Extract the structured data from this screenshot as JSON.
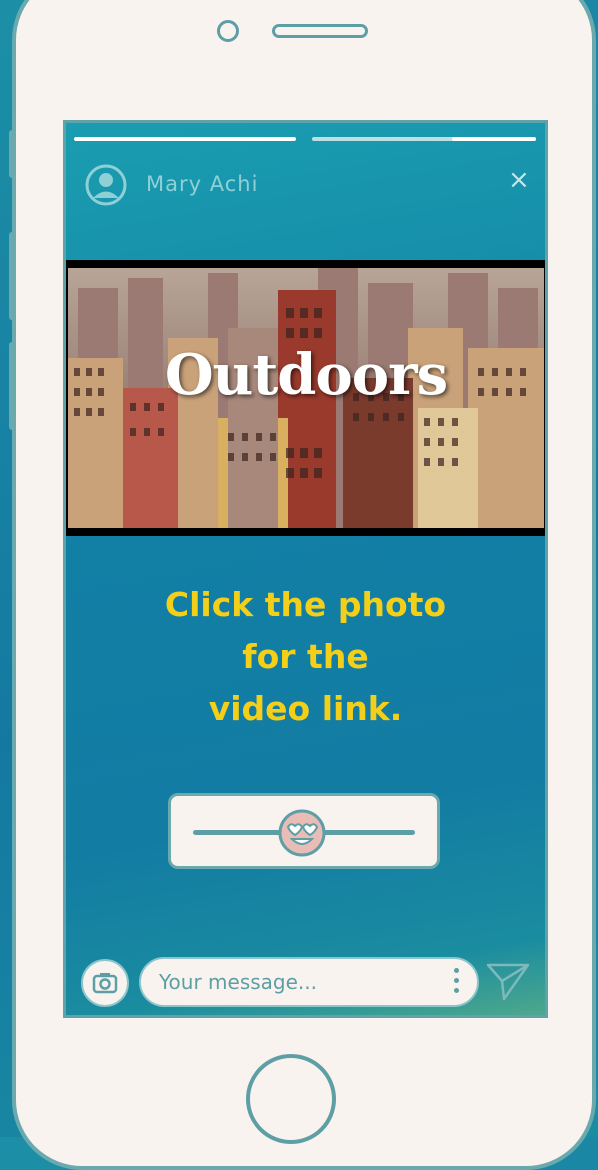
{
  "story": {
    "user_name": "Mary Achi",
    "close_label": "×",
    "progress": [
      1,
      1,
      0.5
    ],
    "photo_title": "Outdoors",
    "cta_lines": [
      "Click the photo",
      "for the",
      "video link."
    ]
  },
  "composer": {
    "placeholder": "Your message...",
    "send_icon": "send-icon",
    "camera_icon": "camera-icon",
    "more_icon": "more-vertical-icon"
  },
  "slider": {
    "emoji": "heart-eyes-emoji-icon",
    "value": 0.45
  },
  "colors": {
    "accent_yellow": "#f4cf1a",
    "teal": "#1479a1",
    "phone_body": "#f8f3ef",
    "outline": "#5e9ea5"
  }
}
